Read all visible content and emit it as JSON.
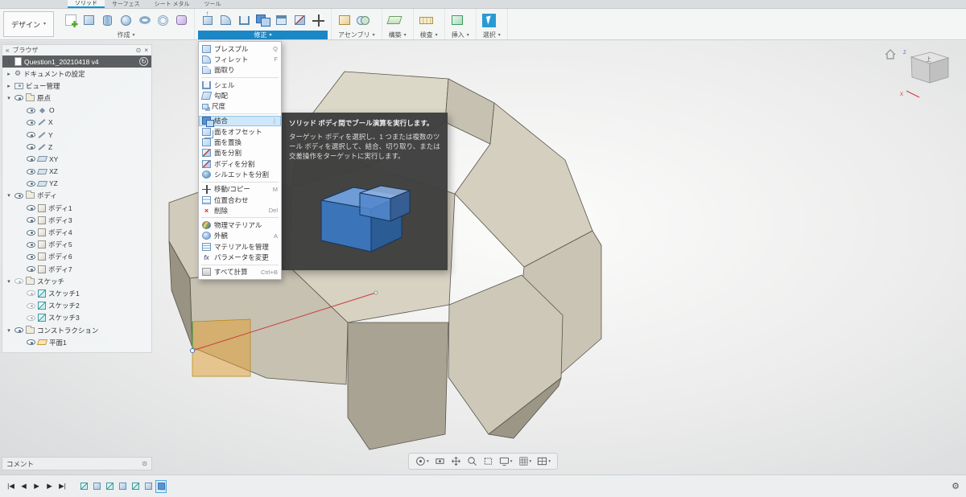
{
  "icons": {
    "caret_down": "▾",
    "tri_open": "▾",
    "tri_closed": "▸",
    "collapse": "«",
    "dock": "⊙",
    "close": "×",
    "sync": "↻",
    "gear": "⚙",
    "more": "⋮",
    "fx": "fx",
    "x_red": "×"
  },
  "tabs": [
    {
      "label": "ソリッド"
    },
    {
      "label": "サーフェス"
    },
    {
      "label": "シート メタル"
    },
    {
      "label": "ツール"
    }
  ],
  "design_button": {
    "label": "デザイン"
  },
  "toolbar": {
    "groups": [
      {
        "label": "作成"
      },
      {
        "label": "修正"
      },
      {
        "label": "アセンブリ"
      },
      {
        "label": "構築"
      },
      {
        "label": "検査"
      },
      {
        "label": "挿入"
      },
      {
        "label": "選択"
      }
    ]
  },
  "browser": {
    "title": "ブラウザ",
    "root_label": "Question1_20210418 v4",
    "items": [
      {
        "label": "ドキュメントの設定"
      },
      {
        "label": "ビュー管理"
      },
      {
        "label": "原点"
      },
      {
        "label": "O"
      },
      {
        "label": "X"
      },
      {
        "label": "Y"
      },
      {
        "label": "Z"
      },
      {
        "label": "XY"
      },
      {
        "label": "XZ"
      },
      {
        "label": "YZ"
      },
      {
        "label": "ボディ"
      },
      {
        "label": "ボディ1"
      },
      {
        "label": "ボディ3"
      },
      {
        "label": "ボディ4"
      },
      {
        "label": "ボディ5"
      },
      {
        "label": "ボディ6"
      },
      {
        "label": "ボディ7"
      },
      {
        "label": "スケッチ"
      },
      {
        "label": "スケッチ1"
      },
      {
        "label": "スケッチ2"
      },
      {
        "label": "スケッチ3"
      },
      {
        "label": "コンストラクション"
      },
      {
        "label": "平面1"
      }
    ]
  },
  "modify_menu": {
    "items": [
      {
        "label": "プレスプル",
        "shortcut": "Q"
      },
      {
        "label": "フィレット",
        "shortcut": "F"
      },
      {
        "label": "面取り",
        "shortcut": ""
      },
      {
        "label": "シェル",
        "shortcut": ""
      },
      {
        "label": "勾配",
        "shortcut": ""
      },
      {
        "label": "尺度",
        "shortcut": ""
      },
      {
        "label": "結合",
        "shortcut": ""
      },
      {
        "label": "面をオフセット",
        "shortcut": ""
      },
      {
        "label": "面を置換",
        "shortcut": ""
      },
      {
        "label": "面を分割",
        "shortcut": ""
      },
      {
        "label": "ボディを分割",
        "shortcut": ""
      },
      {
        "label": "シルエットを分割",
        "shortcut": ""
      },
      {
        "label": "移動/コピー",
        "shortcut": "M"
      },
      {
        "label": "位置合わせ",
        "shortcut": ""
      },
      {
        "label": "削除",
        "shortcut": "Del"
      },
      {
        "label": "物理マテリアル",
        "shortcut": ""
      },
      {
        "label": "外観",
        "shortcut": "A"
      },
      {
        "label": "マテリアルを管理",
        "shortcut": ""
      },
      {
        "label": "パラメータを変更",
        "shortcut": ""
      },
      {
        "label": "すべて計算",
        "shortcut": "Ctrl+B"
      }
    ]
  },
  "tooltip": {
    "title": "ソリッド ボディ間でブール演算を実行します。",
    "body": "ターゲット ボディを選択し、1 つまたは複数のツール ボディを選択して、結合、切り取り、または交差操作をターゲットに実行します。"
  },
  "viewcube": {
    "top_label": "上",
    "x_label": "X",
    "z_label": "Z"
  },
  "comment_panel": {
    "title": "コメント"
  },
  "timeline_bar": {
    "controls": [
      {
        "glyph": "|◀"
      },
      {
        "glyph": "◀"
      },
      {
        "glyph": "▶"
      },
      {
        "glyph": "▶"
      },
      {
        "glyph": "▶|"
      }
    ]
  },
  "colors": {
    "accent": "#0696d7",
    "modify_highlight": "#1c87c5",
    "menu_highlight": "#cfe7f8",
    "model_beige": "#d7d2c2",
    "tooltip_bg": "#3e3e3e"
  }
}
